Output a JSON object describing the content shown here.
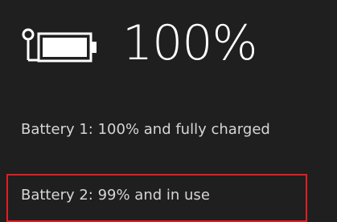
{
  "battery_flyout": {
    "overall_percent_text": "100%",
    "overall_level_fraction": 1.0,
    "icon": "battery-plugged-icon",
    "batteries": [
      {
        "text": "Battery 1: 100% and fully charged"
      },
      {
        "text": "Battery 2: 99% and in use"
      }
    ]
  },
  "colors": {
    "background": "#1f1f1f",
    "text": "#ffffff",
    "secondary_text": "#d6d6d6",
    "highlight": "#e51b23"
  }
}
